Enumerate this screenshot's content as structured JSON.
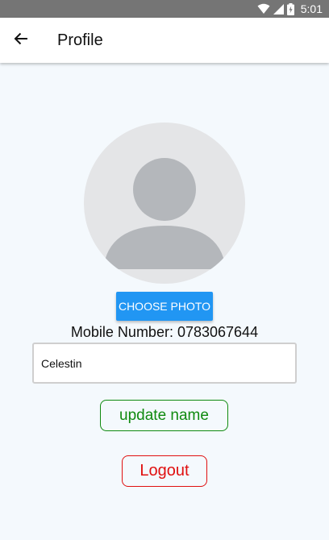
{
  "status_bar": {
    "time": "5:01",
    "icons": [
      "wifi-icon",
      "cellular-signal-icon",
      "battery-charging-icon"
    ],
    "background": "#757575"
  },
  "app_bar": {
    "back_icon": "arrow-left-icon",
    "title": "Profile"
  },
  "profile": {
    "avatar_icon": "default-person-avatar-icon",
    "choose_photo_label": "CHOOSE PHOTO",
    "mobile_label": "Mobile Number:",
    "mobile_number": "0783067644",
    "name_value": "Celestin",
    "update_name_label": "update name",
    "logout_label": "Logout"
  },
  "colors": {
    "background": "#f4f9fd",
    "primary_button": "#2196f3",
    "update_green": "#0f8a0f",
    "logout_red": "#e01010",
    "avatar_bg": "#e4e5e7",
    "avatar_figure": "#b4b7bb"
  }
}
